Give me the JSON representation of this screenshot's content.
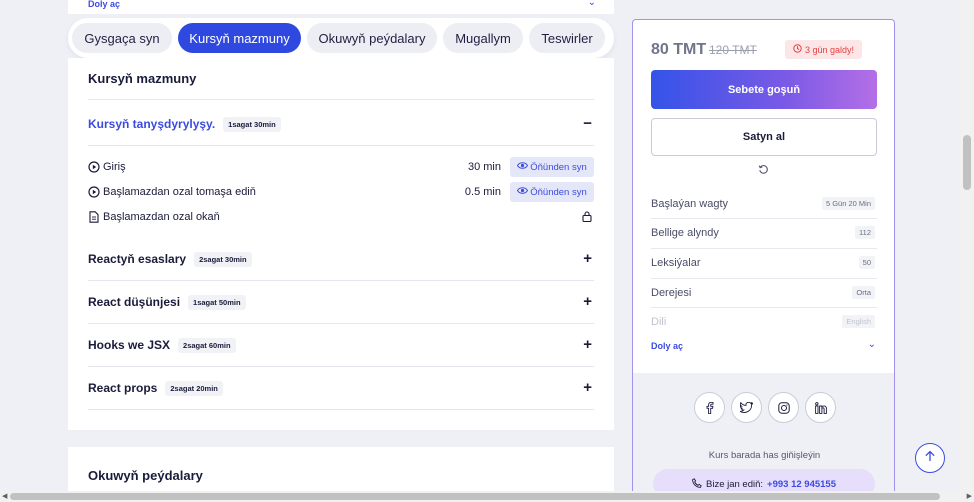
{
  "top": {
    "more_label": "Doly aç"
  },
  "tabs": [
    {
      "label": "Gysgaça syn",
      "active": false
    },
    {
      "label": "Kursyň mazmuny",
      "active": true
    },
    {
      "label": "Okuwyň peýdalary",
      "active": false
    },
    {
      "label": "Mugallym",
      "active": false
    },
    {
      "label": "Teswirler",
      "active": false
    }
  ],
  "content": {
    "title": "Kursyň mazmuny",
    "sections": [
      {
        "title": "Kursyň tanyşdyrylyşy.",
        "duration": "1sagat 30min",
        "expanded": true,
        "toggle": "−",
        "lessons": [
          {
            "title": "Giriş",
            "type": "video",
            "duration": "30 min",
            "preview_label": "Öňünden syn"
          },
          {
            "title": "Başlamazdan ozal tomaşa ediň",
            "type": "video",
            "duration": "0.5 min",
            "preview_label": "Öňünden syn"
          },
          {
            "title": "Başlamazdan ozal okaň",
            "type": "document",
            "locked": true
          }
        ]
      },
      {
        "title": "Reactyň esaslary",
        "duration": "2sagat 30min",
        "expanded": false,
        "toggle": "+"
      },
      {
        "title": "React düşünjesi",
        "duration": "1sagat 50min",
        "expanded": false,
        "toggle": "+"
      },
      {
        "title": "Hooks we JSX",
        "duration": "2sagat 60min",
        "expanded": false,
        "toggle": "+"
      },
      {
        "title": "React props",
        "duration": "2sagat 20min",
        "expanded": false,
        "toggle": "+"
      }
    ]
  },
  "benefits": {
    "title": "Okuwyň peýdalary"
  },
  "sidebar": {
    "price": "80 TMT",
    "old_price": "120 TMT",
    "days_left": "3 gün galdy!",
    "add_to_cart": "Sebete goşuň",
    "buy": "Satyn al",
    "info": [
      {
        "label": "Başlaýan wagty",
        "value": "5 Gün 20 Min"
      },
      {
        "label": "Bellige alyndy",
        "value": "112"
      },
      {
        "label": "Leksiýalar",
        "value": "50"
      },
      {
        "label": "Derejesi",
        "value": "Orta"
      },
      {
        "label": "Dili",
        "value": "English"
      }
    ],
    "more_label": "Doly aç",
    "socials": [
      "facebook-icon",
      "twitter-icon",
      "instagram-icon",
      "linkedin-icon"
    ],
    "ask_text": "Kurs barada has giňişleýin",
    "call_label": "Bize jan ediň:",
    "phone": "+993 12 945155"
  },
  "colors": {
    "accent": "#2f49e0",
    "link": "#3b4be0",
    "danger": "#e34242",
    "sidebar_border": "#a592ea"
  }
}
